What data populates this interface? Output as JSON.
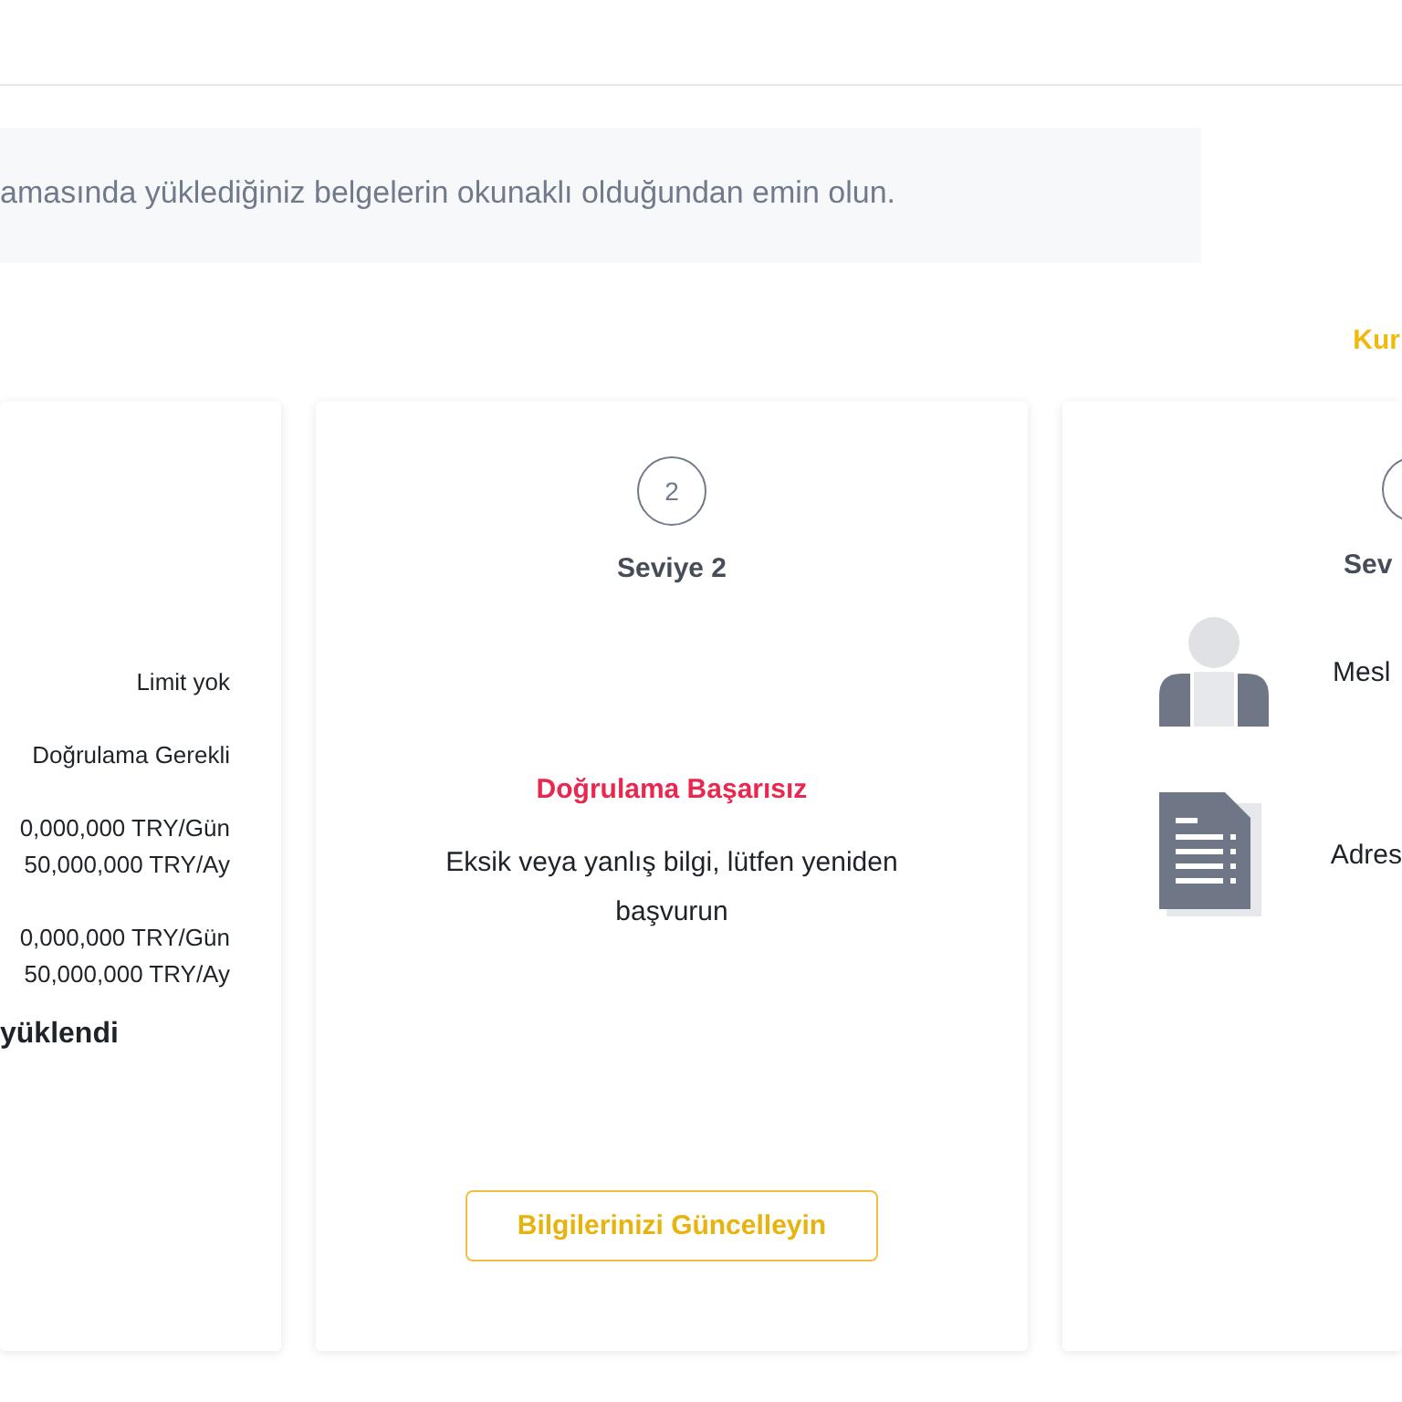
{
  "notice": {
    "text": "amasında yüklediğiniz belgelerin okunaklı olduğundan emin olun."
  },
  "link": {
    "text": "Kur"
  },
  "cards": [
    {
      "kind": "limits",
      "rows": [
        [
          "Limit yok"
        ],
        [
          "Doğrulama Gerekli"
        ],
        [
          "0,000,000 TRY/Gün",
          "50,000,000 TRY/Ay"
        ],
        [
          "0,000,000 TRY/Gün",
          "50,000,000 TRY/Ay"
        ]
      ],
      "footer": "yüklendi"
    },
    {
      "kind": "status",
      "step": "2",
      "title": "Seviye 2",
      "status": "Doğrulama Başarısız",
      "message": "Eksik veya yanlış bilgi, lütfen yeniden başvurun",
      "button": "Bilgilerinizi Güncelleyin"
    },
    {
      "kind": "requirements",
      "title": "Sev",
      "items": [
        {
          "kind": "person",
          "label": "Mesl"
        },
        {
          "kind": "document",
          "label": "Adres"
        }
      ]
    }
  ]
}
